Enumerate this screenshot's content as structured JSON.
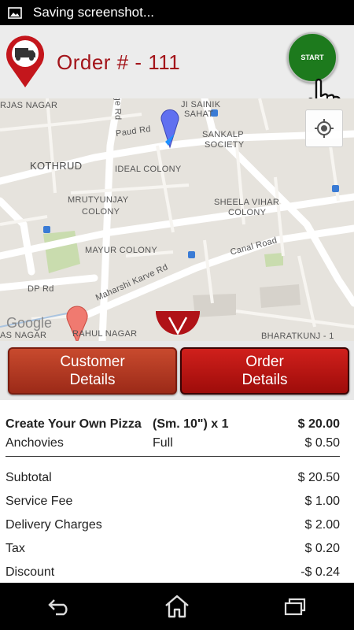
{
  "status_bar": {
    "text": "Saving screenshot...",
    "icon": "image-icon"
  },
  "header": {
    "title": "Order # - 111",
    "logo_icon": "truck-pin-icon",
    "start_label": "START",
    "hand_icon": "pointing-hand-icon"
  },
  "map": {
    "labels": {
      "sainik": "JI SAINIK",
      "sahat": "SAHAT",
      "ge_rd": "ge Rd",
      "paud_rd": "Paud Rd",
      "sankalp": "SANKALP",
      "society": "SOCIETY",
      "kothrud": "KOTHRUD",
      "ideal_colony": "IDEAL COLONY",
      "mrutyunjay": "MRUTYUNJAY",
      "colony1": "COLONY",
      "sheela_vihar": "SHEELA VIHAR",
      "colony2": "COLONY",
      "canal_rd": "Canal Road",
      "mayur_colony": "MAYUR COLONY",
      "dp_rd": "DP Rd",
      "maharshi_rd": "Maharshi Karve Rd",
      "as_nagar": "AS NAGAR",
      "rahul_nagar": "RAHUL NAGAR",
      "bharatkunj": "BHARATKUNJ - 1",
      "rjas": "RJAS NAGAR"
    },
    "google": "Google",
    "locate_icon": "my-location-icon",
    "collapse_icon": "chevron-down-icon",
    "colors": {
      "road": "#ffffff",
      "park": "#c9dcae",
      "land": "#e6e3dd",
      "driver_pin": "#6070f0",
      "dest_pin": "#f07a70"
    }
  },
  "tabs": {
    "customer": "Customer Details",
    "order": "Order Details"
  },
  "items": [
    {
      "name": "Create Your Own Pizza",
      "size": "(Sm. 10\") x 1",
      "price": "$ 20.00"
    },
    {
      "name": "Anchovies",
      "size": "Full",
      "price": "$ 0.50"
    }
  ],
  "totals": [
    {
      "label": "Subtotal",
      "value": "$ 20.50"
    },
    {
      "label": "Service Fee",
      "value": "$ 1.00"
    },
    {
      "label": "Delivery Charges",
      "value": "$ 2.00"
    },
    {
      "label": "Tax",
      "value": "$ 0.20"
    },
    {
      "label": "Discount",
      "value": "-$ 0.24"
    }
  ],
  "nav": {
    "back": "back-icon",
    "home": "home-icon",
    "recents": "recents-icon"
  }
}
